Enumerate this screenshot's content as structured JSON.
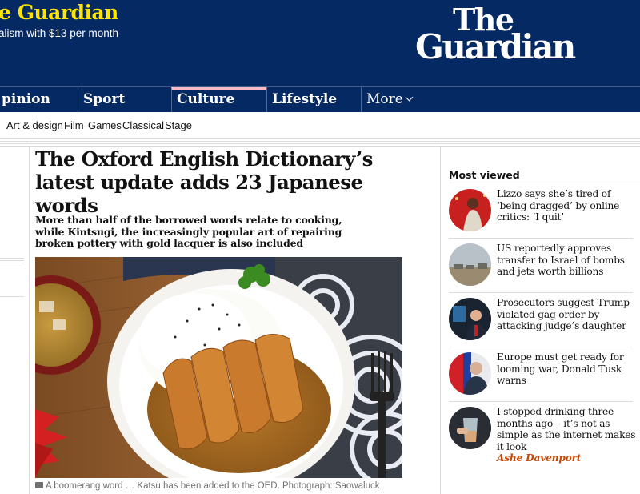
{
  "support": {
    "title": "e Guardian",
    "subtitle": "alism with $13 per month"
  },
  "logo": {
    "line1": "The",
    "line2": "Guardian"
  },
  "pillars": [
    {
      "label": "pinion"
    },
    {
      "label": "Sport"
    },
    {
      "label": "Culture"
    },
    {
      "label": "Lifestyle"
    },
    {
      "label": "More"
    }
  ],
  "subnav": [
    "Art & design",
    "Film",
    "Games",
    "Classical",
    "Stage"
  ],
  "article": {
    "headline": "The Oxford English Dictionary’s latest update adds 23 Japanese words",
    "standfirst": "More than half of the borrowed words relate to cooking, while Kintsugi, the increasingly popular art of repairing broken pottery with gold lacquer is also included",
    "caption": "A boomerang word … Katsu has been added to the OED. Photograph: Saowaluck"
  },
  "most_viewed": {
    "title": "Most viewed",
    "items": [
      {
        "headline": "Lizzo says she’s tired of ‘being dragged’ by online critics: ‘I quit’"
      },
      {
        "headline": "US reportedly approves transfer to Israel of bombs and jets worth billions"
      },
      {
        "headline": "Prosecutors suggest Trump violated gag order by attacking judge’s daughter"
      },
      {
        "headline": "Europe must get ready for looming war, Donald Tusk warns"
      },
      {
        "headline": "I stopped drinking three months ago – it’s not as simple as the internet makes it look",
        "author": "Ashe Davenport"
      }
    ]
  },
  "colors": {
    "brand_blue": "#052962",
    "support_yellow": "#ffe500",
    "culture_accent": "#ffbac8",
    "author_orange": "#c74600"
  }
}
